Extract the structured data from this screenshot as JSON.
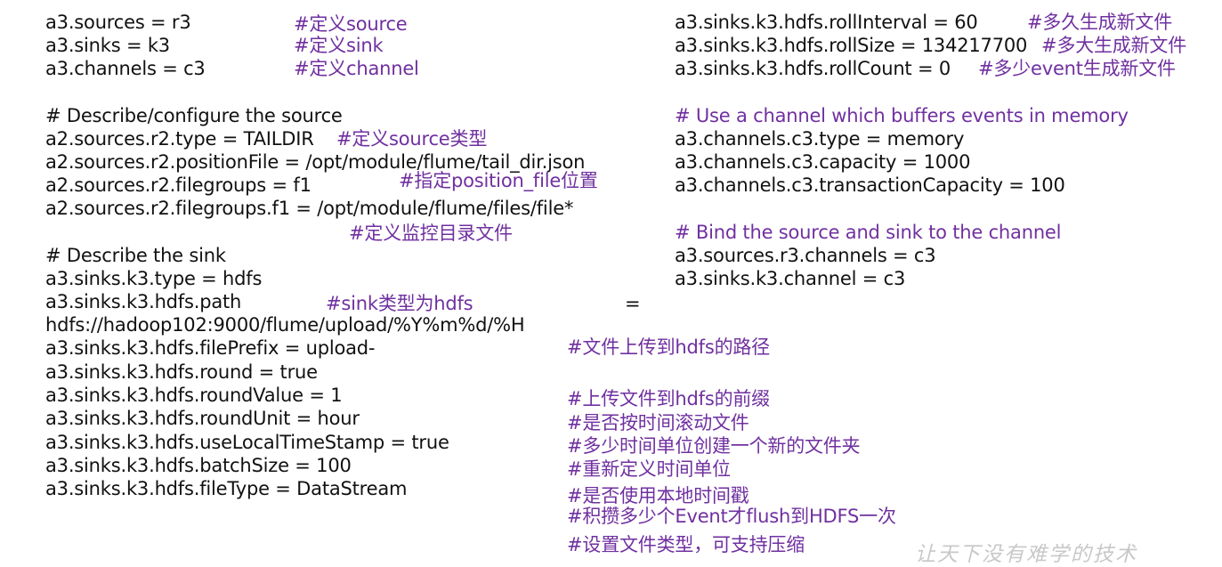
{
  "left_column": {
    "lines": [
      "a3.sources = r3",
      "a3.sinks = k3",
      "a3.channels = c3",
      "# Describe/configure the source",
      "a2.sources.r2.type = TAILDIR",
      "a2.sources.r2.positionFile = /opt/module/flume/tail_dir.json",
      "a2.sources.r2.filegroups = f1",
      "a2.sources.r2.filegroups.f1 = /opt/module/flume/files/file*",
      "# Describe the sink",
      "a3.sinks.k3.type = hdfs",
      "a3.sinks.k3.hdfs.path",
      "=",
      "hdfs://hadoop102:9000/flume/upload/%Y%m%d/%H",
      "a3.sinks.k3.hdfs.filePrefix = upload-",
      "a3.sinks.k3.hdfs.round = true",
      "a3.sinks.k3.hdfs.roundValue = 1",
      "a3.sinks.k3.hdfs.roundUnit = hour",
      "a3.sinks.k3.hdfs.useLocalTimeStamp = true",
      "a3.sinks.k3.hdfs.batchSize = 100",
      "a3.sinks.k3.hdfs.fileType = DataStream"
    ],
    "comments": [
      "#定义source",
      "#定义sink",
      "#定义channel",
      "#定义source类型",
      "#指定position_file位置",
      "#定义监控目录文件",
      "#sink类型为hdfs",
      "#文件上传到hdfs的路径",
      "#上传文件到hdfs的前缀",
      "#是否按时间滚动文件",
      "#多少时间单位创建一个新的文件夹",
      "#重新定义时间单位",
      "#是否使用本地时间戳",
      "#积攒多少个Event才flush到HDFS一次",
      "#设置文件类型，可支持压缩"
    ]
  },
  "right_column": {
    "lines": [
      "a3.sinks.k3.hdfs.rollInterval = 60",
      "a3.sinks.k3.hdfs.rollSize = 134217700",
      "a3.sinks.k3.hdfs.rollCount = 0",
      "a3.channels.c3.type = memory",
      "a3.channels.c3.capacity = 1000",
      "a3.channels.c3.transactionCapacity = 100",
      "a3.sources.r3.channels = c3",
      "a3.sinks.k3.channel = c3"
    ],
    "comments": [
      "#多久生成新文件",
      "#多大生成新文件",
      "#多少event生成新文件",
      "# Use a channel which buffers events in memory",
      "# Bind the source and sink to the channel"
    ]
  },
  "watermark": "让天下没有难学的技术",
  "colors": {
    "text": "#111111",
    "comment": "#7030a0",
    "watermark": "#c8c8c8"
  }
}
